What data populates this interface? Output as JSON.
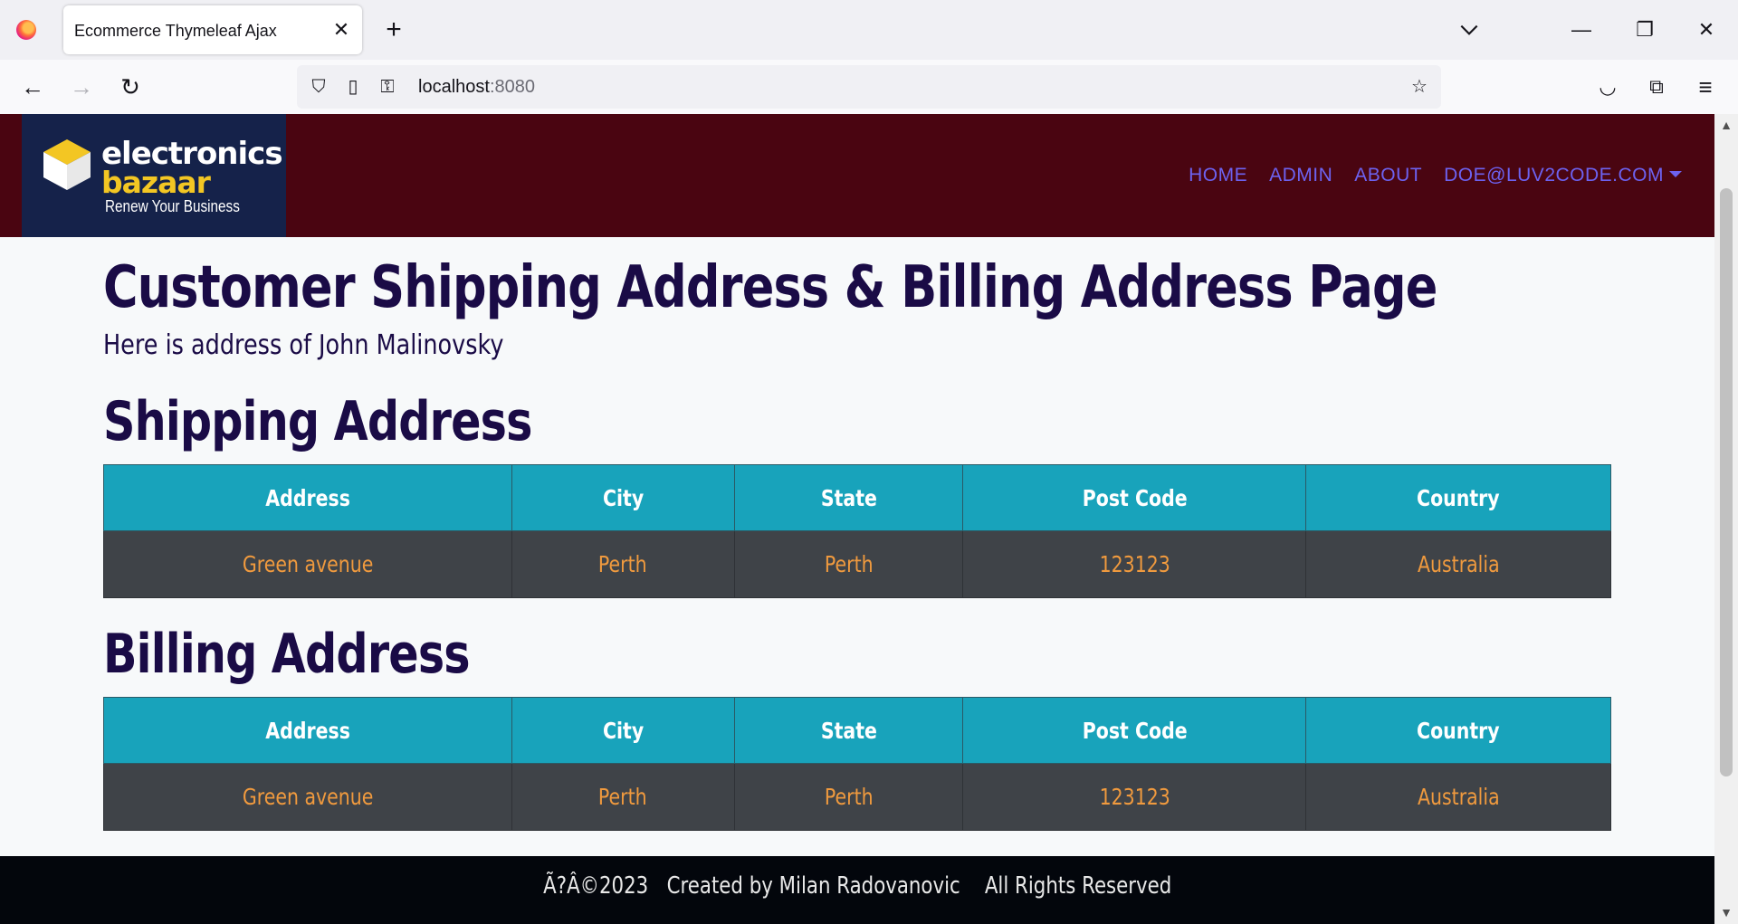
{
  "browser": {
    "tab_title": "Ecommerce Thymeleaf Ajax",
    "url_host": "localhost",
    "url_port": ":8080"
  },
  "site": {
    "logo": {
      "line1": "electronics",
      "line2": "bazaar",
      "tagline": "Renew Your Business"
    },
    "menu": [
      "HOME",
      "ADMIN",
      "ABOUT",
      "DOE@LUV2CODE.COM"
    ]
  },
  "page": {
    "title": "Customer Shipping Address & Billing Address Page",
    "subtitle": "Here is address of John Malinovsky",
    "shipping_heading": "Shipping Address",
    "billing_heading": "Billing Address",
    "columns": [
      "Address",
      "City",
      "State",
      "Post Code",
      "Country"
    ],
    "shipping_row": [
      "Green avenue",
      "Perth",
      "Perth",
      "123123",
      "Australia"
    ],
    "billing_row": [
      "Green avenue",
      "Perth",
      "Perth",
      "123123",
      "Australia"
    ]
  },
  "footer": {
    "text": "Ã?Â©2023   Created by Milan Radovanovic    All Rights Reserved"
  },
  "colors": {
    "header_bg": "#4a0511",
    "logo_bg": "#15224a",
    "table_head": "#18a3bb",
    "table_row": "#3f4348",
    "cell_text": "#f09a3e",
    "menu": "#6d62f0"
  }
}
